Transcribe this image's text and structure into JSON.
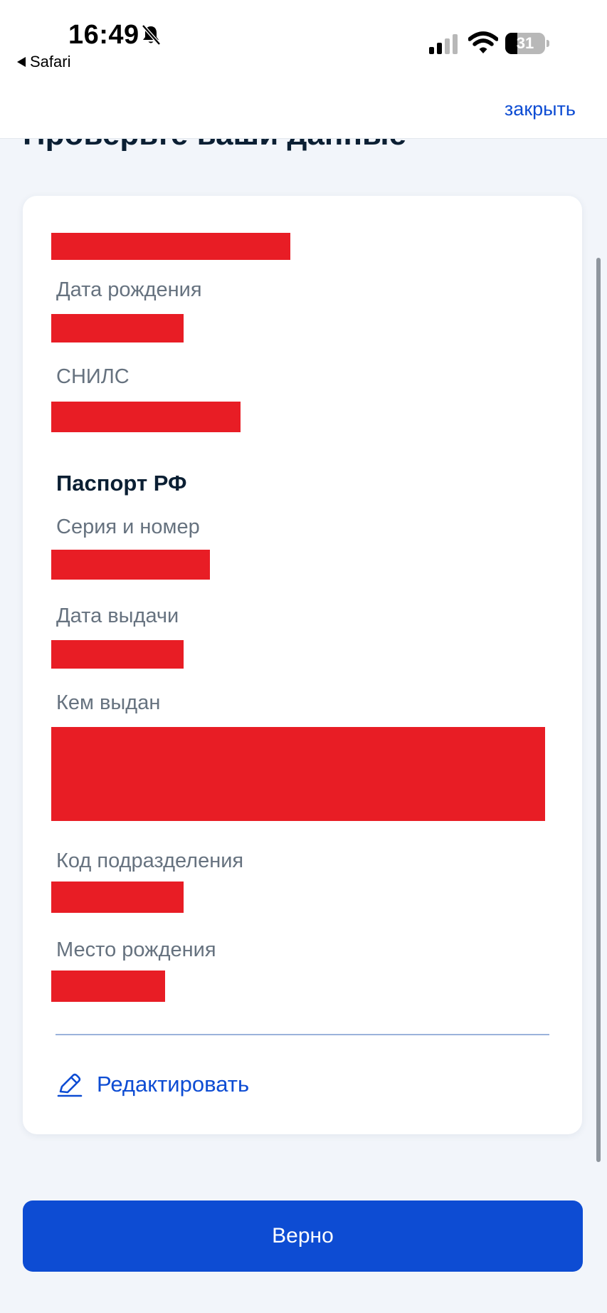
{
  "status_bar": {
    "time": "16:49",
    "back_app": "Safari",
    "battery_level": "31",
    "battery_fraction": 0.31
  },
  "nav": {
    "close_label": "закрыть"
  },
  "page": {
    "title": "Проверьте ваши данные"
  },
  "card": {
    "fields": {
      "birth_date_label": "Дата рождения",
      "snils_label": "СНИЛС"
    },
    "passport": {
      "section_title": "Паспорт РФ",
      "series_number_label": "Серия и номер",
      "issue_date_label": "Дата выдачи",
      "issued_by_label": "Кем выдан",
      "division_code_label": "Код подразделения",
      "birth_place_label": "Место рождения"
    },
    "edit_label": "Редактировать"
  },
  "actions": {
    "confirm_label": "Верно"
  },
  "colors": {
    "accent": "#0d4cd3",
    "redaction": "#e81d25",
    "title_text": "#0b1f33",
    "label_text": "#66727f"
  }
}
